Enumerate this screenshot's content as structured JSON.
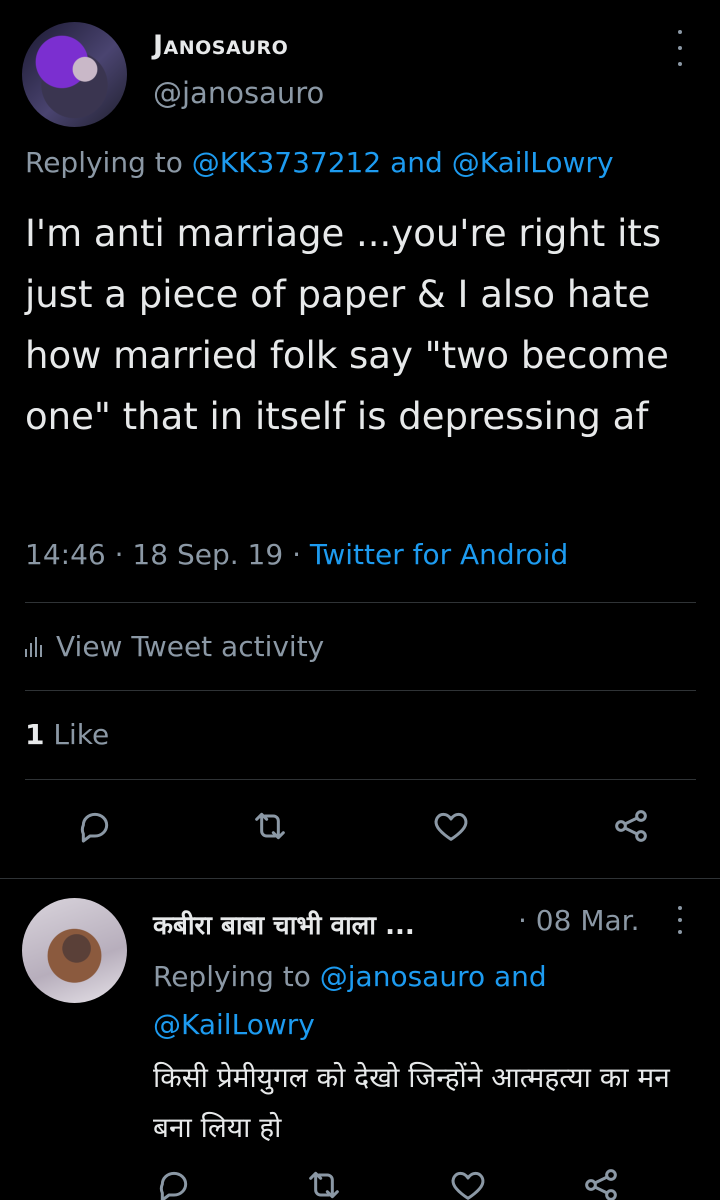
{
  "tweet": {
    "display_name": "Janosauro",
    "handle": "@janosauro",
    "replying_prefix": "Replying to",
    "replying_mention_1": "@KK3737212",
    "replying_and": "and",
    "replying_mention_2": "@KailLowry",
    "text": "I'm anti marriage ...you're right its just a piece of paper & I also hate how married folk say \"two become one\" that in itself is depressing af",
    "time": "14:46",
    "date": "18 Sep. 19",
    "separator": "·",
    "source": "Twitter for Android",
    "activity_label": "View Tweet activity",
    "like_count": "1",
    "like_label": "Like"
  },
  "reply_tweet": {
    "display_name": "कबीरा बाबा चाभी वाला ...",
    "date": "· 08 Mar.",
    "replying_prefix": "Replying to",
    "replying_mention_1": "@janosauro",
    "replying_and": "and",
    "replying_mention_2": "@KailLowry",
    "text": "किसी प्रेमीयुगल को देखो जिन्होंने आत्महत्या का मन बना लिया हो"
  },
  "icons": {
    "reply": "reply-icon",
    "retweet": "retweet-icon",
    "like": "heart-icon",
    "share": "share-icon",
    "more": "more-icon",
    "activity": "bar-chart-icon"
  },
  "colors": {
    "background": "#000000",
    "text": "#e7e9ea",
    "secondary": "#8b98a5",
    "accent": "#1d9bf0",
    "divider": "#2f3336"
  }
}
